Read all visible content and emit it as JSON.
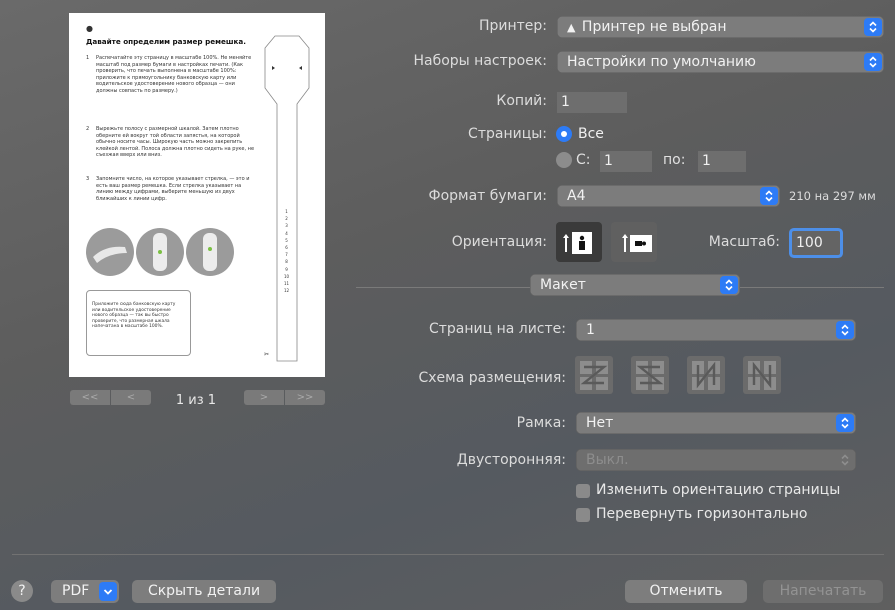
{
  "preview": {
    "apple_logo": "",
    "title": "Давайте определим размер ремешка.",
    "steps": [
      {
        "num": "1",
        "text": "Распечатайте эту страницу в масштабе 100%. Не меняйте масштаб под размер бумаги в настройках печати. (Как проверить, что печать выполнена в масштабе 100%: приложите к прямоугольнику банковскую карту или водительское удостоверение нового образца — они должны совпасть по размеру.)"
      },
      {
        "num": "2",
        "text": "Вырежьте полосу с размерной шкалой. Затем плотно оберните ей вокруг той области запястья, на которой обычно носите часы. Широкую часть можно закрепить клейкой лентой. Полоса должна плотно сидеть на руке, не съезжая вверх или вниз."
      },
      {
        "num": "3",
        "text": "Запомните число, на которое указывает стрелка, — это и есть ваш размер ремешка. Если стрелка указывает на линию между цифрами, выберите меньшую из двух ближайших к линии цифр."
      }
    ],
    "card_note": "Приложите сюда банковскую карту или водительское удостоверение нового образца — так вы быстро проверите, что размерная шкала напечатана в масштабе 100%.",
    "ruler_numbers": [
      "1",
      "2",
      "3",
      "4",
      "5",
      "6",
      "7",
      "8",
      "9",
      "10",
      "11",
      "12"
    ],
    "page_indicator": "1 из 1",
    "nav_first": "<<",
    "nav_prev": "<",
    "nav_next": ">",
    "nav_last": ">>"
  },
  "printer": {
    "label": "Принтер:",
    "value": "Принтер не выбран"
  },
  "presets": {
    "label": "Наборы настроек:",
    "value": "Настройки по умолчанию"
  },
  "copies": {
    "label": "Копий:",
    "value": "1"
  },
  "pages": {
    "label": "Страницы:",
    "all_label": "Все",
    "from_label": "С:",
    "from_value": "1",
    "to_label": "по:",
    "to_value": "1"
  },
  "paper_size": {
    "label": "Формат бумаги:",
    "value": "A4",
    "dimensions": "210 на 297 мм"
  },
  "orientation": {
    "label": "Ориентация:"
  },
  "scale": {
    "label": "Масштаб:",
    "value": "100"
  },
  "section": {
    "value": "Макет"
  },
  "pages_per_sheet": {
    "label": "Страниц на листе:",
    "value": "1"
  },
  "layout_direction": {
    "label": "Схема размещения:"
  },
  "border": {
    "label": "Рамка:",
    "value": "Нет"
  },
  "two_sided": {
    "label": "Двусторонняя:",
    "value": "Выкл."
  },
  "reverse_orientation": {
    "label": "Изменить ориентацию страницы"
  },
  "flip_horizontal": {
    "label": "Перевернуть горизонтально"
  },
  "footer": {
    "help": "?",
    "pdf": "PDF",
    "hide_details": "Скрыть детали",
    "cancel": "Отменить",
    "print": "Напечатать"
  },
  "colors": {
    "accent": "#2d7bf6",
    "background": "#646464",
    "control": "#7c7c7c"
  }
}
